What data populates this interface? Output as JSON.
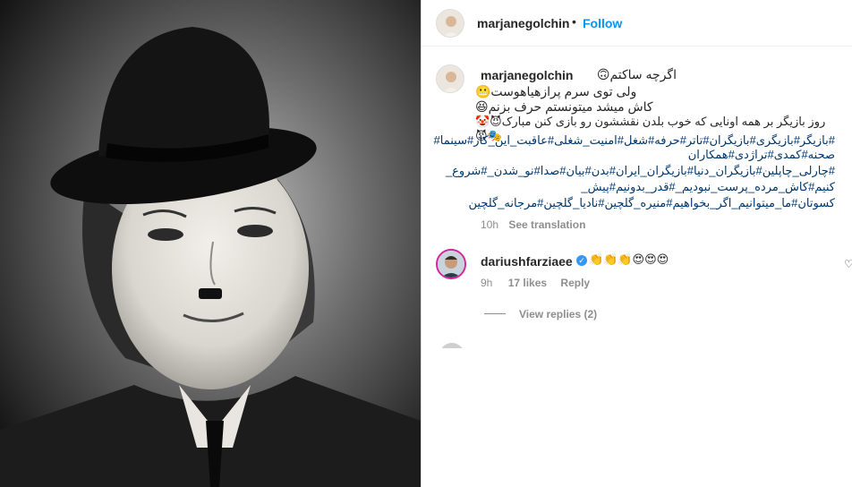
{
  "post": {
    "username": "marjanegolchin",
    "separator": "•",
    "follow_label": "Follow"
  },
  "caption": {
    "username": "marjanegolchin",
    "line1": "اگرچه ساکتم🙃",
    "line2": "ولی توی سرم پرازهیاهوست😬",
    "line3": "کاش میشد میتونستم حرف بزنم😆",
    "line4": "روز بازیگر بر همه اونایی که خوب بلدن نقششون رو بازی کنن مبارک😈🤡🎭😈",
    "hashtags": [
      "#بازیگر#بازیگری#بازیگران#تاتر#حرفه#شغل#امنیت_شغلی#عاقبت_این_کار#سینما#",
      "صحنه#کمدی#تراژدی#همکاران",
      "#چارلی_چاپلین#بازیگران_دنیا#بازیگران_ایران#بدن#بیان#صدا#نو_شدن_#شروع_",
      "کنیم#کاش_مرده_پرست_نبودیم_#قدر_بدونیم#پیش_",
      "کسوتان#ما_میتوانیم_اگر_بخواهیم#منیره_گلچین#نادیا_گلچین#مرجانه_گلچین"
    ],
    "time": "10h",
    "see_translation": "See translation"
  },
  "comments": [
    {
      "username": "dariushfarziaee",
      "verified": true,
      "text": "👏👏👏😍😍😍",
      "time": "9h",
      "likes": "17 likes",
      "reply_label": "Reply",
      "view_replies": "View replies (2)"
    }
  ],
  "icons": {
    "heart": "heart-icon",
    "verified": "verified-badge-icon"
  },
  "colors": {
    "link_blue": "#0095f6",
    "hashtag_blue": "#00376b",
    "muted": "#8e8e8e"
  }
}
